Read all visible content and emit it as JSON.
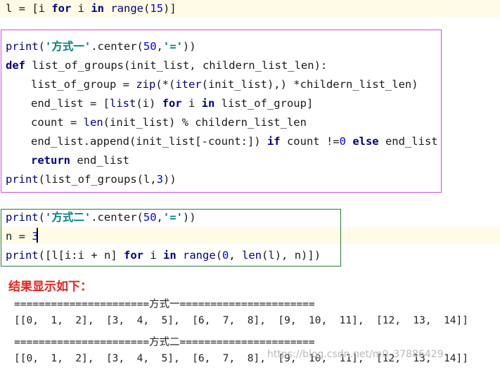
{
  "code_top": {
    "p1": "l = [i ",
    "kw_for": "for",
    "p2": " i ",
    "kw_in": "in",
    "sp": " ",
    "range": "range",
    "p3": "(",
    "n15": "15",
    "p4": ")]"
  },
  "method1": {
    "l1": {
      "print": "print",
      "open": "(",
      "q1": "'",
      "text": "方式一",
      "q2": "'",
      "center": ".center(",
      "n50": "50",
      "comma": ",",
      "q3": "'",
      "eq": "=",
      "q4": "'",
      "close": "))"
    },
    "l2": {
      "def": "def",
      "rest": " list_of_groups(init_list, childern_list_len):"
    },
    "l3": {
      "a": "list_of_group = ",
      "zip": "zip",
      "b": "(*(",
      "iter": "iter",
      "c": "(init_list),) *childern_list_len)"
    },
    "l4": {
      "a": "end_list = [",
      "list": "list",
      "b": "(i) ",
      "for": "for",
      "c": " i ",
      "in": "in",
      "d": " list_of_group]"
    },
    "l5": {
      "a": "count = ",
      "len": "len",
      "b": "(init_list) % childern_list_len"
    },
    "l6": {
      "a": "end_list.append(init_list[-count:]) ",
      "if": "if",
      "b": " count !=",
      "zero": "0",
      "c": " ",
      "else": "else",
      "d": " end_list"
    },
    "l7": {
      "ret": "return",
      "a": " end_list"
    },
    "l8": {
      "print": "print",
      "a": "(list_of_groups(l,",
      "three": "3",
      "b": "))"
    }
  },
  "method2": {
    "l1": {
      "print": "print",
      "open": "(",
      "q1": "'",
      "text": "方式二",
      "q2": "'",
      "center": ".center(",
      "n50": "50",
      "comma": ",",
      "q3": "'",
      "eq": "=",
      "q4": "'",
      "close": "))"
    },
    "l2": {
      "a": "n = ",
      "three": "3"
    },
    "l3": {
      "print": "print",
      "a": "([l[i:i + n] ",
      "for": "for",
      "b": " i ",
      "in": "in",
      "sp": " ",
      "range": "range",
      "c": "(",
      "zero": "0",
      "d": ", ",
      "len": "len",
      "e": "(l), n)])"
    }
  },
  "result": {
    "title": "结果显示如下：",
    "lines": [
      "======================方式一======================",
      "[[0,  1,  2],  [3,  4,  5],  [6,  7,  8],  [9,  10,  11],  [12,  13,  14]]",
      "======================方式二======================",
      "[[0,  1,  2],  [3,  4,  5],  [6,  7,  8],  [9,  10,  11],  [12,  13,  14]]"
    ]
  },
  "watermark": "https://blog.csdn.net/m0_37886429"
}
